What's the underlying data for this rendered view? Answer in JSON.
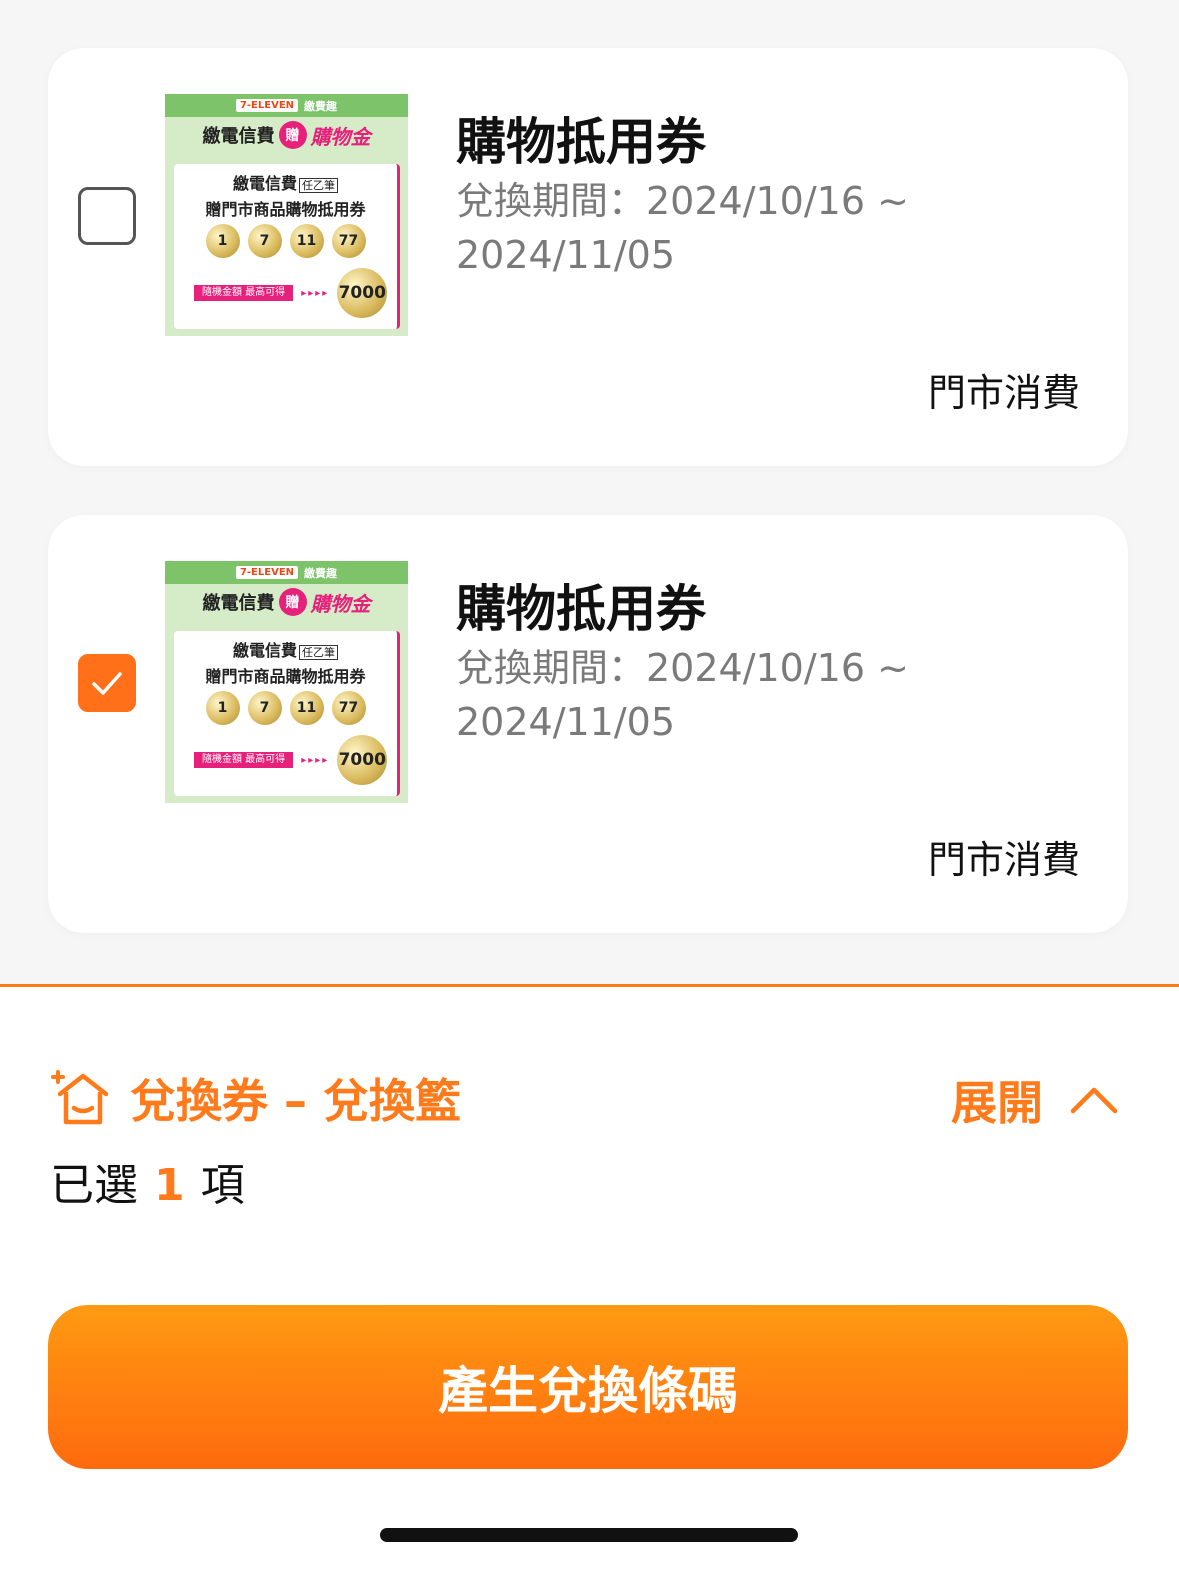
{
  "coupons": [
    {
      "title": "購物抵用券",
      "period": "兌換期間：2024/10/16 ~ 2024/11/05",
      "channel": "門市消費",
      "checked": false,
      "image": {
        "brand": "7-ELEVEN",
        "brand_sub": "繳費趣",
        "headline_left": "繳電信費",
        "gift": "贈",
        "headline_right": "購物金",
        "line1": "繳電信費",
        "tag": "任乙筆",
        "line2": "贈門市商品購物抵用券",
        "coins": [
          "1",
          "7",
          "11",
          "77"
        ],
        "pink_label": "隨機金額 最高可得",
        "arrows": "▸▸▸▸",
        "big_coin": "7000"
      }
    },
    {
      "title": "購物抵用券",
      "period": "兌換期間：2024/10/16 ~ 2024/11/05",
      "channel": "門市消費",
      "checked": true,
      "image": {
        "brand": "7-ELEVEN",
        "brand_sub": "繳費趣",
        "headline_left": "繳電信費",
        "gift": "贈",
        "headline_right": "購物金",
        "line1": "繳電信費",
        "tag": "任乙筆",
        "line2": "贈門市商品購物抵用券",
        "coins": [
          "1",
          "7",
          "11",
          "77"
        ],
        "pink_label": "隨機金額 最高可得",
        "arrows": "▸▸▸▸",
        "big_coin": "7000"
      }
    }
  ],
  "basket": {
    "icon": "house-plus-icon",
    "title": "兌換券 – 兌換籃",
    "expand_label": "展開",
    "selected_prefix": "已選",
    "selected_count": "1",
    "selected_suffix": "項"
  },
  "generate_button": "產生兌換條碼",
  "colors": {
    "accent": "#ff7a1a",
    "button_top": "#ff9a12",
    "button_bottom": "#ff6a0e"
  }
}
